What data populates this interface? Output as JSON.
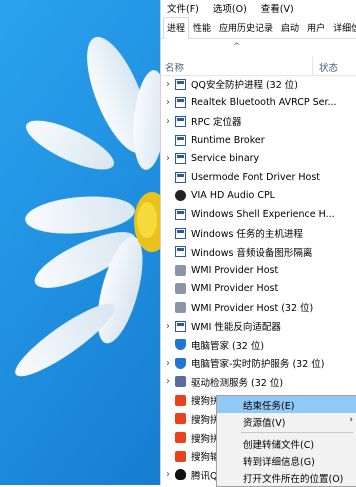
{
  "menu": [
    "文件(F)",
    "选项(O)",
    "查看(V)"
  ],
  "tabs": [
    "进程",
    "性能",
    "应用历史记录",
    "启动",
    "用户",
    "详细信息"
  ],
  "columns": {
    "name": "名称",
    "status": "状态"
  },
  "rows": [
    {
      "label": "QQ安全防护进程 (32 位)",
      "icon": "window-icon",
      "expand": true
    },
    {
      "label": "Realtek Bluetooth AVRCP Ser...",
      "icon": "window-icon",
      "expand": true
    },
    {
      "label": "RPC 定位器",
      "icon": "window-icon",
      "expand": true
    },
    {
      "label": "Runtime Broker",
      "icon": "window-icon",
      "expand": false
    },
    {
      "label": "Service binary",
      "icon": "window-icon",
      "expand": true
    },
    {
      "label": "Usermode Font Driver Host",
      "icon": "window-icon",
      "expand": false
    },
    {
      "label": "VIA HD Audio CPL",
      "icon": "speaker-icon",
      "expand": false
    },
    {
      "label": "Windows Shell Experience H...",
      "icon": "window-icon",
      "expand": false
    },
    {
      "label": "Windows 任务的主机进程",
      "icon": "window-icon",
      "expand": false
    },
    {
      "label": "Windows 音频设备图形隔离",
      "icon": "window-icon",
      "expand": false
    },
    {
      "label": "WMI Provider Host",
      "icon": "wmi-icon",
      "expand": false
    },
    {
      "label": "WMI Provider Host",
      "icon": "wmi-icon",
      "expand": false
    },
    {
      "label": "WMI Provider Host (32 位)",
      "icon": "wmi-icon",
      "expand": false
    },
    {
      "label": "WMI 性能反向适配器",
      "icon": "window-icon",
      "expand": true
    },
    {
      "label": "电脑管家 (32 位)",
      "icon": "shield-icon",
      "expand": false
    },
    {
      "label": "电脑管家-实时防护服务 (32 位)",
      "icon": "shield-icon",
      "expand": true
    },
    {
      "label": "驱动检测服务 (32 位)",
      "icon": "service-icon",
      "expand": true
    },
    {
      "label": "搜狗拼音",
      "icon": "sogou-icon",
      "expand": false
    },
    {
      "label": "搜狗拼音",
      "icon": "sogou-icon",
      "expand": false
    },
    {
      "label": "搜狗拼音",
      "icon": "sogou-icon",
      "expand": false
    },
    {
      "label": "搜狗输入",
      "icon": "sogou-icon",
      "expand": false
    },
    {
      "label": "腾讯QQ",
      "icon": "qq-icon",
      "expand": true
    }
  ],
  "context_menu": [
    {
      "label": "结束任务(E)",
      "highlight": true
    },
    {
      "label": "资源值(V)",
      "submenu": true
    },
    {
      "label": "创建转储文件(C)"
    },
    {
      "label": "转到详细信息(G)"
    },
    {
      "label": "打开文件所在的位置(O)"
    }
  ],
  "colors": {
    "accent": "#90c8f6",
    "header_text": "#4d6082"
  }
}
